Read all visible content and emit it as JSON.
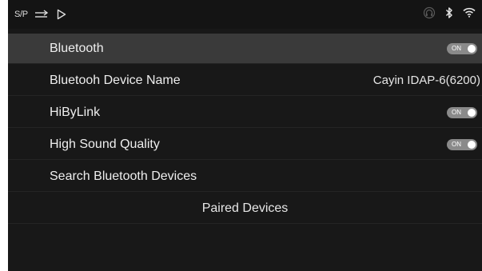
{
  "status_bar": {
    "mode_label": "S/P",
    "icons": [
      "shuffle-arrows-icon",
      "play-icon",
      "headphone-icon",
      "bluetooth-icon",
      "wifi-icon"
    ]
  },
  "settings": {
    "bluetooth": {
      "label": "Bluetooth",
      "toggle": "ON",
      "enabled": true
    },
    "device_name": {
      "label": "Bluetooh Device Name",
      "value": "Cayin IDAP-6(6200)"
    },
    "hibylink": {
      "label": "HiByLink",
      "toggle": "ON",
      "enabled": true
    },
    "high_sound_quality": {
      "label": "High Sound Quality",
      "toggle": "ON",
      "enabled": true
    },
    "search_devices": {
      "label": "Search Bluetooth Devices"
    },
    "paired_devices": {
      "label": "Paired Devices"
    }
  },
  "colors": {
    "background": "#181818",
    "selected_row": "#3a3a3a",
    "toggle_on": "#8a8a8a"
  }
}
